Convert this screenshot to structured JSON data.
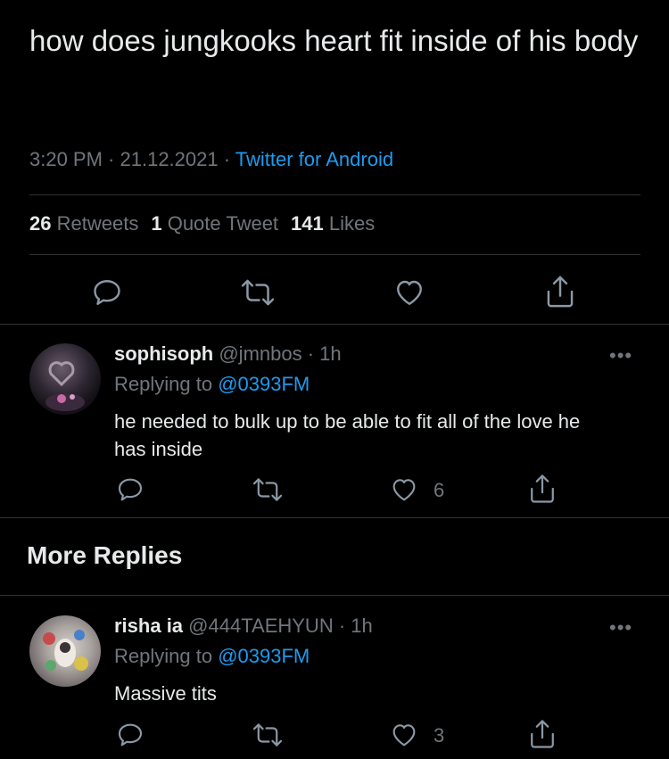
{
  "tweet": {
    "text": "how does jungkooks heart fit inside of his body",
    "time": "3:20 PM",
    "sep1": " · ",
    "date": "21.12.2021",
    "sep2": " · ",
    "source": "Twitter for Android",
    "stats": {
      "retweets_count": "26",
      "retweets_label": "Retweets",
      "quotes_count": "1",
      "quotes_label": "Quote Tweet",
      "likes_count": "141",
      "likes_label": "Likes"
    }
  },
  "replies": [
    {
      "name": "sophisoph",
      "handle": "@jmnbos",
      "time": " · 1h",
      "replying_prefix": "Replying to ",
      "replying_to": "@0393FM",
      "text": "he needed to bulk up to be able to fit all of the love he has inside",
      "likes": "6",
      "more": "•••"
    }
  ],
  "more_replies": {
    "title": "More Replies"
  },
  "more_replies_items": [
    {
      "name": "risha ia",
      "handle": "@444TAEHYUN",
      "time": " · 1h",
      "replying_prefix": "Replying to ",
      "replying_to": "@0393FM",
      "text": "Massive tits",
      "likes": "3",
      "more": "•••"
    }
  ],
  "icons": {
    "reply": "reply-icon",
    "retweet": "retweet-icon",
    "like": "heart-icon",
    "share": "share-icon",
    "more": "more-icon"
  },
  "colors": {
    "background": "#000000",
    "text": "#e7e9ea",
    "muted": "#71767b",
    "accent": "#1d9bf0",
    "divider": "#2f3336"
  }
}
